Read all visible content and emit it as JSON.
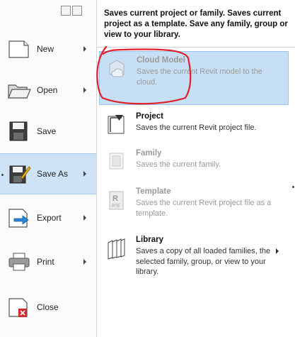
{
  "menu": {
    "items": [
      {
        "label": "New",
        "has_submenu": true
      },
      {
        "label": "Open",
        "has_submenu": true
      },
      {
        "label": "Save",
        "has_submenu": false
      },
      {
        "label": "Save As",
        "has_submenu": true
      },
      {
        "label": "Export",
        "has_submenu": true
      },
      {
        "label": "Print",
        "has_submenu": true
      },
      {
        "label": "Close",
        "has_submenu": false
      }
    ]
  },
  "saveas": {
    "header": "Saves current project or family. Saves current project as a template. Save any family, group or view to your library.",
    "options": [
      {
        "title": "Cloud Model",
        "description": "Saves the current Revit model to the cloud.",
        "icon": "cloud-model-icon",
        "state": "highlighted-disabled"
      },
      {
        "title": "Project",
        "description": "Saves the current Revit project file.",
        "icon": "project-icon",
        "state": "enabled"
      },
      {
        "title": "Family",
        "description": "Saves the current family.",
        "icon": "family-icon",
        "state": "disabled"
      },
      {
        "title": "Template",
        "description": "Saves the current Revit project file as a template.",
        "icon": "template-icon",
        "state": "disabled"
      },
      {
        "title": "Library",
        "description": "Saves a copy of all loaded families, the selected family, group, or view to your library.",
        "icon": "library-icon",
        "state": "enabled",
        "has_submenu": true
      }
    ]
  },
  "colors": {
    "highlight": "#c7dff5",
    "annotation": "#e0202a"
  }
}
